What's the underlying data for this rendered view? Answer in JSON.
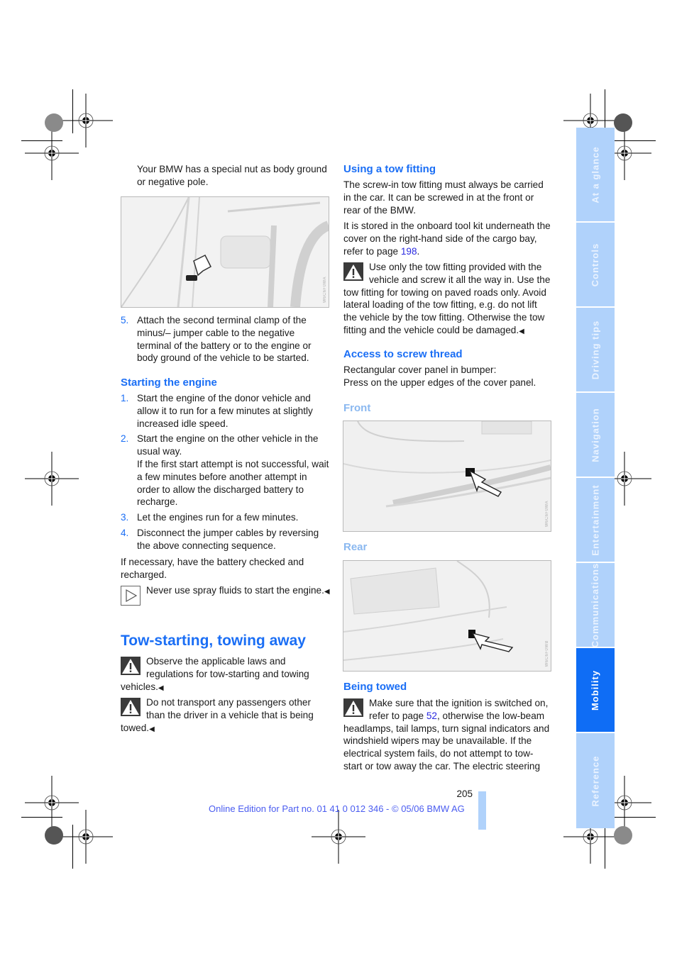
{
  "left_column": {
    "intro": "Your BMW has a special nut as body ground or negative pole.",
    "figure1_code": "W6C6F0WA",
    "step5": {
      "num": "5.",
      "text": "Attach the second terminal clamp of the minus/– jumper cable to the negative terminal of the battery or to the engine or body ground of the vehicle to be started."
    },
    "starting_heading": "Starting the engine",
    "steps": [
      {
        "num": "1.",
        "text": "Start the engine of the donor vehicle and allow it to run for a few minutes at slightly increased idle speed."
      },
      {
        "num": "2.",
        "text": "Start the engine on the other vehicle in the usual way.",
        "extra": "If the first start attempt is not successful, wait a few minutes before another attempt in order to allow the discharged battery to recharge."
      },
      {
        "num": "3.",
        "text": "Let the engines run for a few minutes."
      },
      {
        "num": "4.",
        "text": "Disconnect the jumper cables by reversing the above connecting sequence."
      }
    ],
    "battery_note": "If necessary, have the battery checked and recharged.",
    "spray_note": "Never use spray fluids to start the engine.",
    "tow_heading": "Tow-starting, towing away",
    "warning1": "Observe the applicable laws and regulations for tow-starting and towing vehicles.",
    "warning2": "Do not transport any passengers other than the driver in a vehicle that is being towed.",
    "end_mark": "◀"
  },
  "right_column": {
    "using_heading": "Using a tow fitting",
    "using_p1": "The screw-in tow fitting must always be carried in the car. It can be screwed in at the front or rear of the BMW.",
    "using_p2_pre": "It is stored in the onboard tool kit underneath the cover on the right-hand side of the cargo bay, refer to page ",
    "using_p2_link": "198",
    "using_p2_post": ".",
    "using_warning": "Use only the tow fitting provided with the vehicle and screw it all the way in. Use the tow fitting for towing on paved roads only. Avoid lateral loading of the tow fitting, e.g. do not lift the vehicle by the tow fitting. Otherwise the tow fitting and the vehicle could be damaged.",
    "access_heading": "Access to screw thread",
    "access_line1": "Rectangular cover panel in bumper:",
    "access_line2": "Press on the upper edges of the cover panel.",
    "front_label": "Front",
    "front_code": "W6C6F0WA",
    "rear_label": "Rear",
    "rear_code": "W6C6F0WB",
    "towed_heading": "Being towed",
    "towed_warning_pre": "Make sure that the ignition is switched on, refer to page ",
    "towed_warning_link": "52",
    "towed_warning_post": ", otherwise the low-beam headlamps, tail lamps, turn signal indicators and windshield wipers may be unavailable. If the electrical system fails, do not attempt to tow-start or tow away the car. The electric steering",
    "end_mark": "◀"
  },
  "side_tabs": [
    {
      "label": "At a glance",
      "active": false
    },
    {
      "label": "Controls",
      "active": false
    },
    {
      "label": "Driving tips",
      "active": false
    },
    {
      "label": "Navigation",
      "active": false
    },
    {
      "label": "Entertainment",
      "active": false
    },
    {
      "label": "Communications",
      "active": false
    },
    {
      "label": "Mobility",
      "active": true
    },
    {
      "label": "Reference",
      "active": false
    }
  ],
  "footer": {
    "page_number": "205",
    "edition": "Online Edition for Part no. 01 41 0 012 346 - © 05/06 BMW AG"
  },
  "colors": {
    "heading_blue": "#1a6ef5",
    "subheading_light_blue": "#8ab8f0",
    "tab_inactive": "#b0d2fb",
    "tab_active": "#0f6df5",
    "link": "#2a2ae0"
  }
}
